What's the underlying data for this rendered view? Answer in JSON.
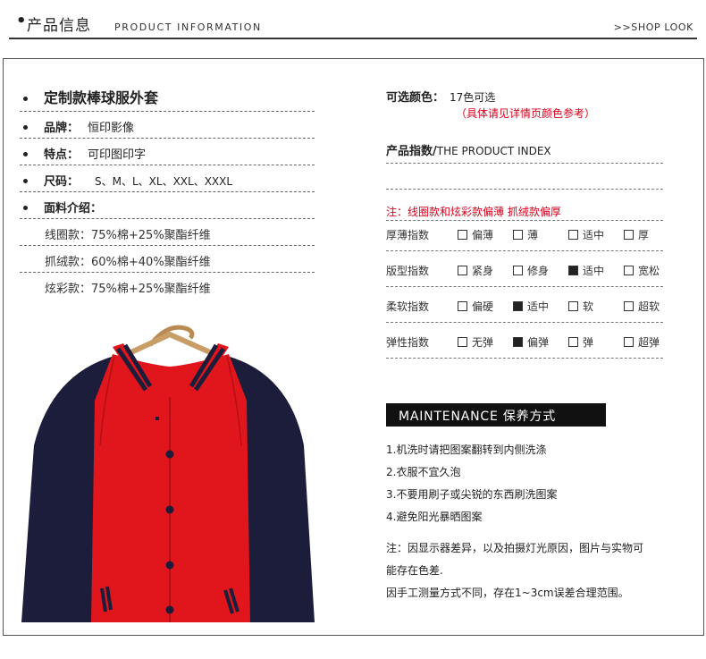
{
  "header": {
    "bullet": "•",
    "title": "产品信息",
    "subtitle": "PRODUCT INFORMATION",
    "right_link": ">>SHOP LOOK"
  },
  "product": {
    "name": "定制款棒球服外套",
    "brand_label": "品牌：",
    "brand_value": "恒印影像",
    "feature_label": "特点：",
    "feature_value": "可印图印字",
    "size_label": "尺码：",
    "size_value": "S、M、L、XL、XXL、XXXL",
    "fabric_label": "面料介绍：",
    "fabrics": [
      "线圈款：75%棉+25%聚酯纤维",
      "抓绒款：60%棉+40%聚酯纤维",
      "炫彩款：75%棉+25%聚酯纤维"
    ]
  },
  "colors": {
    "label": "可选颜色：",
    "value": "17色可选",
    "hint": "（具体请见详情页颜色参考）"
  },
  "index": {
    "title_cn": "产品指数/",
    "title_en": "THE PRODUCT INDEX",
    "note": "注：线圈款和炫彩款偏薄  抓绒款偏厚",
    "rows": [
      {
        "label": "厚薄指数",
        "options": [
          {
            "text": "偏薄",
            "checked": false
          },
          {
            "text": "薄",
            "checked": false
          },
          {
            "text": "适中",
            "checked": false
          },
          {
            "text": "厚",
            "checked": false
          }
        ]
      },
      {
        "label": "版型指数",
        "options": [
          {
            "text": "紧身",
            "checked": false
          },
          {
            "text": "修身",
            "checked": false
          },
          {
            "text": "适中",
            "checked": true
          },
          {
            "text": "宽松",
            "checked": false
          }
        ]
      },
      {
        "label": "柔软指数",
        "options": [
          {
            "text": "偏硬",
            "checked": false
          },
          {
            "text": "适中",
            "checked": true
          },
          {
            "text": "软",
            "checked": false
          },
          {
            "text": "超软",
            "checked": false
          }
        ]
      },
      {
        "label": "弹性指数",
        "options": [
          {
            "text": "无弹",
            "checked": false
          },
          {
            "text": "偏弹",
            "checked": true
          },
          {
            "text": "弹",
            "checked": false
          },
          {
            "text": "超弹",
            "checked": false
          }
        ]
      }
    ]
  },
  "maintenance": {
    "title": "MAINTENANCE  保养方式",
    "items": [
      "1.机洗时请把图案翻转到内侧洗涤",
      "2.衣服不宜久泡",
      "3.不要用刷子或尖锐的东西刷洗图案",
      "4.避免阳光暴晒图案"
    ],
    "note_line1": "注：因显示器差异，以及拍摄灯光原因，图片与实物可",
    "note_line2": "能存在色差.",
    "note_line3": "因手工测量方式不同，存在1~3cm误差合理范围。"
  },
  "palette": {
    "red": "#e0161c",
    "navy": "#1b1d3a",
    "accent": "#d6001c"
  }
}
